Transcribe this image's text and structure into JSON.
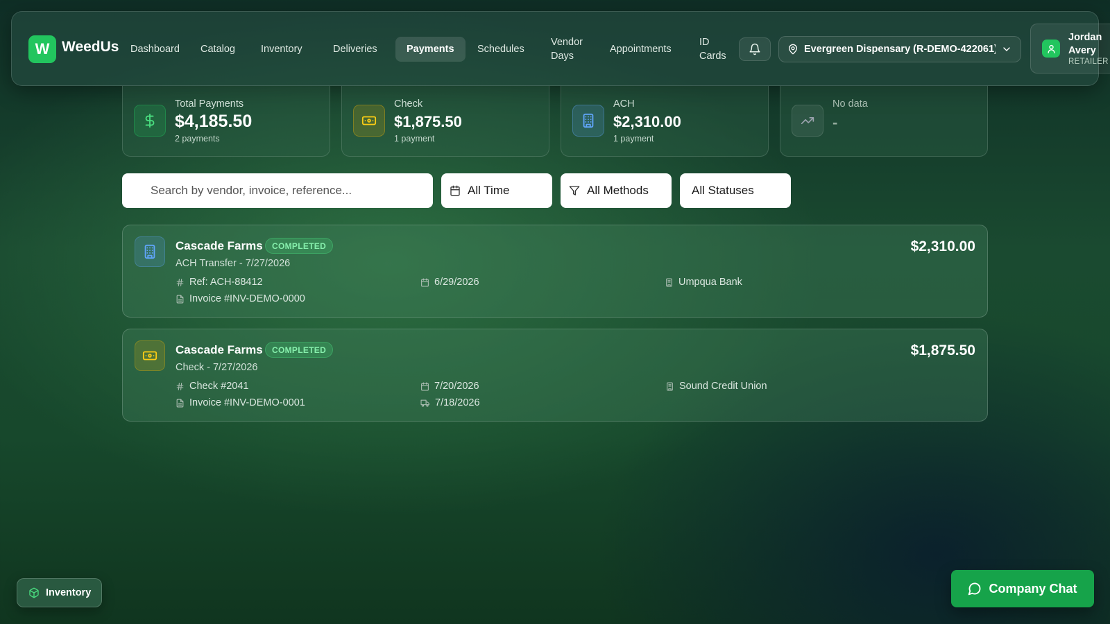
{
  "brand": {
    "logo_letter": "W",
    "name": "WeedUs",
    "accent": "#22c55e"
  },
  "nav": {
    "items": [
      {
        "label": "Dashboard"
      },
      {
        "label": "Catalog"
      },
      {
        "label": "Inventory"
      },
      {
        "label": "Deliveries"
      },
      {
        "label": "Payments",
        "active": true
      },
      {
        "label": "Schedules"
      },
      {
        "label": "Vendor Days"
      },
      {
        "label": "Appointments"
      },
      {
        "label": "ID Cards"
      }
    ],
    "bell_icon": "bell-icon",
    "location": "Evergreen Dispensary (R-DEMO-422061)",
    "user": {
      "first": "Jordan",
      "last": "Avery",
      "role": "RETAILER"
    }
  },
  "stats": [
    {
      "label": "Total Payments",
      "value": "$4,185.50",
      "sub": "2 payments",
      "icon": "dollar-icon",
      "color": "#22c55e"
    },
    {
      "label": "Check",
      "value": "$1,875.50",
      "sub": "1 payment",
      "icon": "banknote-icon",
      "color": "#eab308"
    },
    {
      "label": "ACH",
      "value": "$2,310.00",
      "sub": "1 payment",
      "icon": "bank-icon",
      "color": "#60a5fa"
    },
    {
      "label": "No data",
      "value": "-",
      "sub": "",
      "icon": "trend-icon",
      "color": "#9ca3af"
    }
  ],
  "filters": {
    "search_placeholder": "Search by vendor, invoice, reference...",
    "time": "All Time",
    "method": "All Methods",
    "status": "All Statuses"
  },
  "payments": [
    {
      "vendor": "Cascade Farms",
      "status": "COMPLETED",
      "subtitle": "ACH Transfer - 7/27/2026",
      "amount": "$2,310.00",
      "reference": "Ref: ACH-88412",
      "invoice": "Invoice #INV-DEMO-0000",
      "date": "6/29/2026",
      "bank": "Umpqua Bank",
      "icon": "bank-icon"
    },
    {
      "vendor": "Cascade Farms",
      "status": "COMPLETED",
      "subtitle": "Check - 7/27/2026",
      "amount": "$1,875.50",
      "reference": "Check #2041",
      "invoice": "Invoice #INV-DEMO-0001",
      "date": "7/20/2026",
      "delivery_date": "7/18/2026",
      "bank": "Sound Credit Union",
      "icon": "banknote-icon"
    }
  ],
  "floating": {
    "inventory_label": "Inventory",
    "chat_label": "Company Chat"
  }
}
